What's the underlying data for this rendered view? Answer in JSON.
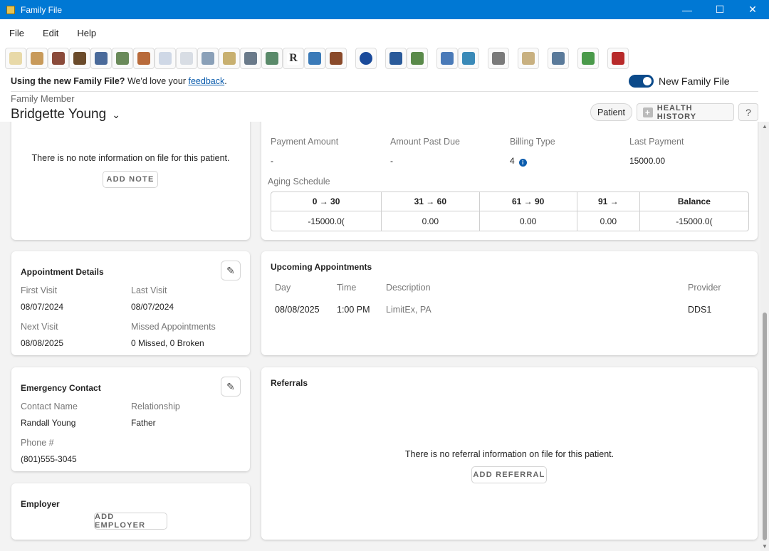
{
  "window": {
    "title": "Family File",
    "controls": [
      "—",
      "☐",
      "✕"
    ]
  },
  "menu": {
    "items": [
      "File",
      "Edit",
      "Help"
    ]
  },
  "toolbar": {
    "buttons": [
      {
        "name": "tooth-icon",
        "color": "#e8d9a8"
      },
      {
        "name": "notepad-icon",
        "color": "#c89a5a"
      },
      {
        "name": "books-icon",
        "color": "#8a4a3a"
      },
      {
        "name": "chair-icon",
        "color": "#6a4a2a"
      },
      {
        "name": "id-card-icon",
        "color": "#4a6a9a"
      },
      {
        "name": "globe-icon",
        "color": "#6a8a5a"
      },
      {
        "name": "brush-icon",
        "color": "#b86a3a"
      },
      {
        "name": "form-icon",
        "color": "#cfd8e6"
      },
      {
        "name": "form-blank-icon",
        "color": "#d8dde4"
      },
      {
        "name": "card-icon",
        "color": "#8aa0b8"
      },
      {
        "name": "money-icon",
        "color": "#c8b070"
      },
      {
        "name": "ledger-icon",
        "color": "#6a7a8a"
      },
      {
        "name": "document-icon",
        "color": "#5a8a6a"
      },
      {
        "name": "rx-icon",
        "color": "#ffffff"
      },
      {
        "name": "pen-icon",
        "color": "#3a7ab8"
      },
      {
        "name": "box-icon",
        "color": "#8a4a2a"
      },
      {
        "name": "info-icon",
        "color": "#1a4a9a"
      },
      {
        "name": "person-chart-icon",
        "color": "#2a5a9a"
      },
      {
        "name": "people-icon",
        "color": "#5a8a4a"
      },
      {
        "name": "network-icon",
        "color": "#4a7ab8"
      },
      {
        "name": "schedule-icon",
        "color": "#3a8ab8"
      },
      {
        "name": "printer-icon",
        "color": "#7a7a7a"
      },
      {
        "name": "scroll-icon",
        "color": "#c8b080"
      },
      {
        "name": "certificate-icon",
        "color": "#5a7a9a"
      },
      {
        "name": "referral-icon",
        "color": "#4a9a4a"
      },
      {
        "name": "reader-icon",
        "color": "#b82a2a"
      }
    ]
  },
  "banner": {
    "bold": "Using the new Family File?",
    "text": "We'd love your",
    "link": "feedback",
    "end": "."
  },
  "toggle": {
    "label": "New Family File",
    "on": true
  },
  "family_member": {
    "label": "Family Member",
    "name": "Bridgette Young"
  },
  "actions": {
    "patient": "Patient",
    "health_history": "HEALTH HISTORY",
    "help": "?"
  },
  "notes": {
    "empty": "There is no note information on file for this patient.",
    "add": "ADD NOTE"
  },
  "billing": {
    "payment_amount_label": "Payment Amount",
    "payment_amount": "-",
    "amount_past_due_label": "Amount Past Due",
    "amount_past_due": "-",
    "billing_type_label": "Billing Type",
    "billing_type": "4",
    "last_payment_label": "Last Payment",
    "last_payment": "15000.00",
    "aging_label": "Aging Schedule",
    "aging_headers": [
      "0 → 30",
      "31 → 60",
      "61 → 90",
      "91 →",
      "Balance"
    ],
    "aging_values": [
      "-15000.0(",
      "0.00",
      "0.00",
      "0.00",
      "-15000.0("
    ]
  },
  "appointment_details": {
    "title": "Appointment Details",
    "first_visit_label": "First Visit",
    "first_visit": "08/07/2024",
    "last_visit_label": "Last Visit",
    "last_visit": "08/07/2024",
    "next_visit_label": "Next Visit",
    "next_visit": "08/08/2025",
    "missed_label": "Missed Appointments",
    "missed": "0 Missed, 0 Broken"
  },
  "upcoming": {
    "title": "Upcoming Appointments",
    "headers": {
      "day": "Day",
      "time": "Time",
      "description": "Description",
      "provider": "Provider"
    },
    "rows": [
      {
        "day": "08/08/2025",
        "time": "1:00 PM",
        "description": "LimitEx, PA",
        "provider": "DDS1"
      }
    ]
  },
  "emergency": {
    "title": "Emergency Contact",
    "name_label": "Contact Name",
    "name": "Randall Young",
    "relationship_label": "Relationship",
    "relationship": "Father",
    "phone_label": "Phone #",
    "phone": "(801)555-3045"
  },
  "referrals": {
    "title": "Referrals",
    "empty": "There is no referral information on file for this patient.",
    "add": "ADD REFERRAL"
  },
  "employer": {
    "title": "Employer",
    "add": "ADD EMPLOYER"
  }
}
